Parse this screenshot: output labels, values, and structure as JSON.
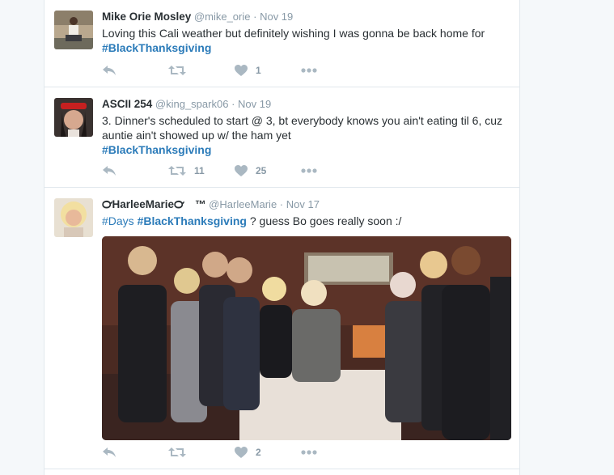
{
  "tweets": [
    {
      "fullname": "Mike Orie Mosley",
      "username": "@mike_orie",
      "dot": "·",
      "time": "Nov 19",
      "text_before": "Loving this Cali weather but definitely wishing I was gonna be back home for",
      "hashtag": "#BlackThanksgiving",
      "retweets": "",
      "likes": "1"
    },
    {
      "fullname": "ASCII 254",
      "username": "@king_spark06",
      "dot": "·",
      "time": "Nov 19",
      "text_before": "3. Dinner's scheduled to start @ 3, bt everybody knows you ain't eating til 6, cuz auntie ain't showed up w/ the ham yet",
      "hashtag": "#BlackThanksgiving",
      "retweets": "11",
      "likes": "25"
    },
    {
      "fullname": "℺HarleeMarie℺ ™",
      "username": "@HarleeMarie",
      "dot": "·",
      "time": "Nov 17",
      "hashtag_days": "#Days",
      "hashtag": "#BlackThanksgiving",
      "text_after": "?  guess Bo goes really soon  :/",
      "retweets": "",
      "likes": "2"
    }
  ],
  "icons": {
    "reply": "reply-icon",
    "retweet": "retweet-icon",
    "like": "heart-icon",
    "more": "more-icon"
  },
  "colors": {
    "link": "#2b7bb9",
    "muted": "#8899a6",
    "icon": "#aab8c2"
  }
}
